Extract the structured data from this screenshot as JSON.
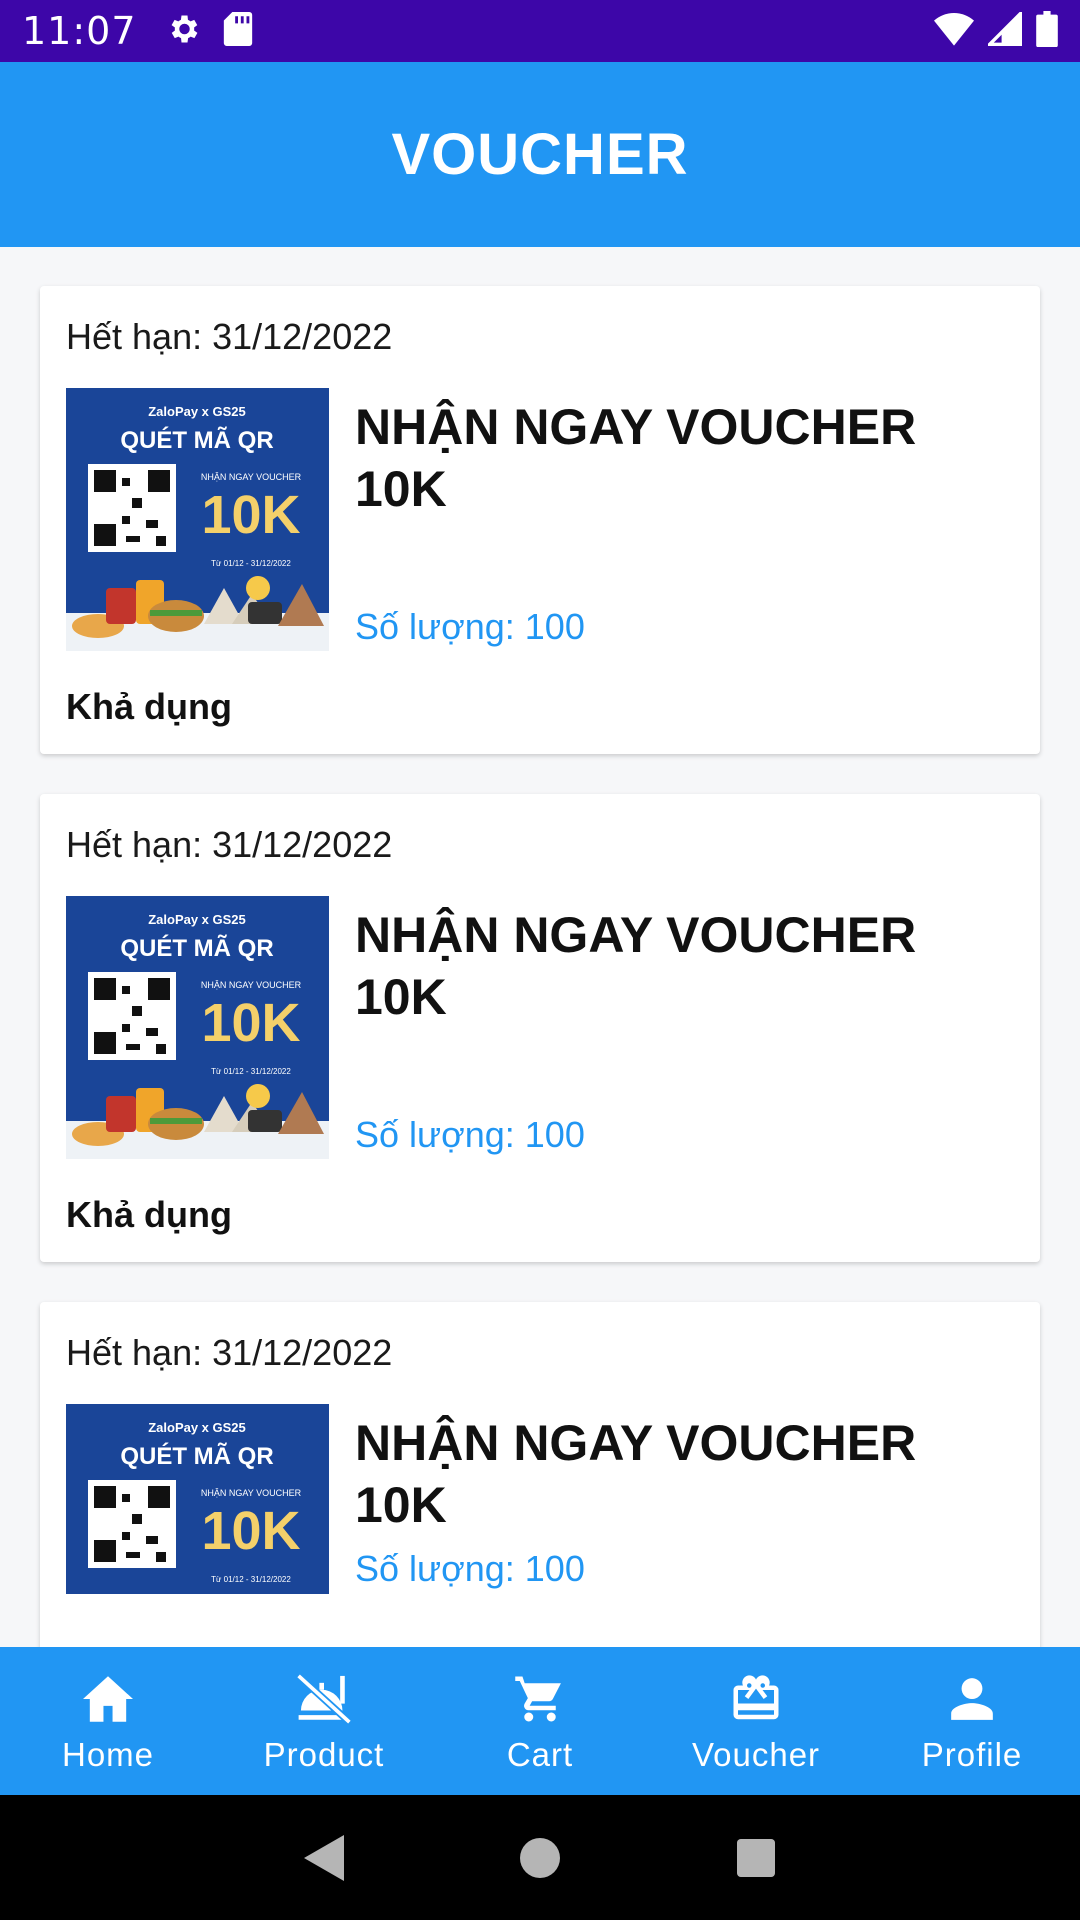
{
  "status_bar": {
    "time": "11:07",
    "icons": [
      "gear-icon",
      "sd-card-icon",
      "wifi-icon",
      "signal-icon",
      "battery-icon"
    ]
  },
  "app_bar": {
    "title": "VOUCHER"
  },
  "colors": {
    "primary": "#2196f3",
    "status_bar": "#3d06a8",
    "quantity_text": "#2196f3"
  },
  "vouchers": [
    {
      "expiry": "Hết hạn: 31/12/2022",
      "name": "NHẬN NGAY VOUCHER 10K",
      "quantity": "Số lượng: 100",
      "status": "Khả dụng",
      "poster": {
        "brand": "ZaloPay x GS25",
        "headline": "QUÉT MÃ QR",
        "sub": "NHẬN NGAY VOUCHER",
        "amount": "10K",
        "dates": "Từ 01/12 - 31/12/2022"
      }
    },
    {
      "expiry": "Hết hạn: 31/12/2022",
      "name": "NHẬN NGAY VOUCHER 10K",
      "quantity": "Số lượng: 100",
      "status": "Khả dụng",
      "poster": {
        "brand": "ZaloPay x GS25",
        "headline": "QUÉT MÃ QR",
        "sub": "NHẬN NGAY VOUCHER",
        "amount": "10K",
        "dates": "Từ 01/12 - 31/12/2022"
      }
    },
    {
      "expiry": "Hết hạn: 31/12/2022",
      "name": "NHẬN NGAY VOUCHER 10K",
      "quantity": "Số lượng: 100",
      "status": "",
      "poster": {
        "brand": "ZaloPay x GS25",
        "headline": "QUÉT MÃ QR",
        "sub": "NHẬN NGAY VOUCHER",
        "amount": "10K",
        "dates": "Từ 01/12 - 31/12/2022"
      }
    }
  ],
  "bottom_nav": {
    "items": [
      {
        "label": "Home",
        "icon": "home-icon"
      },
      {
        "label": "Product",
        "icon": "product-icon"
      },
      {
        "label": "Cart",
        "icon": "cart-icon"
      },
      {
        "label": "Voucher",
        "icon": "voucher-icon"
      },
      {
        "label": "Profile",
        "icon": "profile-icon"
      }
    ]
  }
}
